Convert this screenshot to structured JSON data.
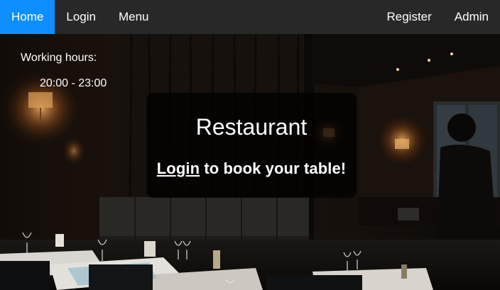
{
  "nav": {
    "left": [
      {
        "label": "Home",
        "active": true
      },
      {
        "label": "Login",
        "active": false
      },
      {
        "label": "Menu",
        "active": false
      }
    ],
    "right": [
      {
        "label": "Register"
      },
      {
        "label": "Admin"
      }
    ]
  },
  "hours": {
    "label": "Working hours:",
    "value": "20:00 - 23:00"
  },
  "hero": {
    "title": "Restaurant",
    "login_link": "Login",
    "login_suffix": " to book your table!"
  },
  "colors": {
    "nav_bg": "#282828",
    "nav_active": "#0f8fff",
    "text": "#ffffff"
  }
}
